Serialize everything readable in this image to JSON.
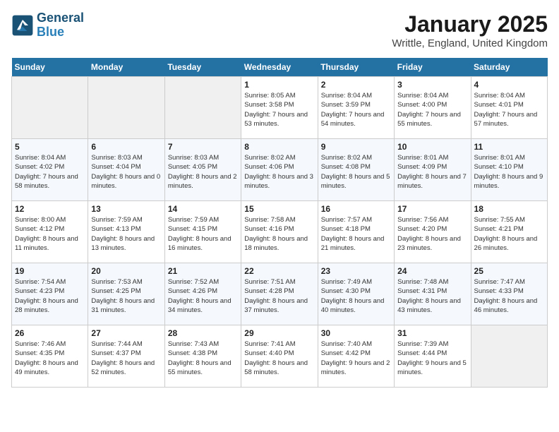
{
  "header": {
    "logo_line1": "General",
    "logo_line2": "Blue",
    "month": "January 2025",
    "location": "Writtle, England, United Kingdom"
  },
  "weekdays": [
    "Sunday",
    "Monday",
    "Tuesday",
    "Wednesday",
    "Thursday",
    "Friday",
    "Saturday"
  ],
  "weeks": [
    [
      {
        "day": "",
        "info": ""
      },
      {
        "day": "",
        "info": ""
      },
      {
        "day": "",
        "info": ""
      },
      {
        "day": "1",
        "info": "Sunrise: 8:05 AM\nSunset: 3:58 PM\nDaylight: 7 hours and 53 minutes."
      },
      {
        "day": "2",
        "info": "Sunrise: 8:04 AM\nSunset: 3:59 PM\nDaylight: 7 hours and 54 minutes."
      },
      {
        "day": "3",
        "info": "Sunrise: 8:04 AM\nSunset: 4:00 PM\nDaylight: 7 hours and 55 minutes."
      },
      {
        "day": "4",
        "info": "Sunrise: 8:04 AM\nSunset: 4:01 PM\nDaylight: 7 hours and 57 minutes."
      }
    ],
    [
      {
        "day": "5",
        "info": "Sunrise: 8:04 AM\nSunset: 4:02 PM\nDaylight: 7 hours and 58 minutes."
      },
      {
        "day": "6",
        "info": "Sunrise: 8:03 AM\nSunset: 4:04 PM\nDaylight: 8 hours and 0 minutes."
      },
      {
        "day": "7",
        "info": "Sunrise: 8:03 AM\nSunset: 4:05 PM\nDaylight: 8 hours and 2 minutes."
      },
      {
        "day": "8",
        "info": "Sunrise: 8:02 AM\nSunset: 4:06 PM\nDaylight: 8 hours and 3 minutes."
      },
      {
        "day": "9",
        "info": "Sunrise: 8:02 AM\nSunset: 4:08 PM\nDaylight: 8 hours and 5 minutes."
      },
      {
        "day": "10",
        "info": "Sunrise: 8:01 AM\nSunset: 4:09 PM\nDaylight: 8 hours and 7 minutes."
      },
      {
        "day": "11",
        "info": "Sunrise: 8:01 AM\nSunset: 4:10 PM\nDaylight: 8 hours and 9 minutes."
      }
    ],
    [
      {
        "day": "12",
        "info": "Sunrise: 8:00 AM\nSunset: 4:12 PM\nDaylight: 8 hours and 11 minutes."
      },
      {
        "day": "13",
        "info": "Sunrise: 7:59 AM\nSunset: 4:13 PM\nDaylight: 8 hours and 13 minutes."
      },
      {
        "day": "14",
        "info": "Sunrise: 7:59 AM\nSunset: 4:15 PM\nDaylight: 8 hours and 16 minutes."
      },
      {
        "day": "15",
        "info": "Sunrise: 7:58 AM\nSunset: 4:16 PM\nDaylight: 8 hours and 18 minutes."
      },
      {
        "day": "16",
        "info": "Sunrise: 7:57 AM\nSunset: 4:18 PM\nDaylight: 8 hours and 21 minutes."
      },
      {
        "day": "17",
        "info": "Sunrise: 7:56 AM\nSunset: 4:20 PM\nDaylight: 8 hours and 23 minutes."
      },
      {
        "day": "18",
        "info": "Sunrise: 7:55 AM\nSunset: 4:21 PM\nDaylight: 8 hours and 26 minutes."
      }
    ],
    [
      {
        "day": "19",
        "info": "Sunrise: 7:54 AM\nSunset: 4:23 PM\nDaylight: 8 hours and 28 minutes."
      },
      {
        "day": "20",
        "info": "Sunrise: 7:53 AM\nSunset: 4:25 PM\nDaylight: 8 hours and 31 minutes."
      },
      {
        "day": "21",
        "info": "Sunrise: 7:52 AM\nSunset: 4:26 PM\nDaylight: 8 hours and 34 minutes."
      },
      {
        "day": "22",
        "info": "Sunrise: 7:51 AM\nSunset: 4:28 PM\nDaylight: 8 hours and 37 minutes."
      },
      {
        "day": "23",
        "info": "Sunrise: 7:49 AM\nSunset: 4:30 PM\nDaylight: 8 hours and 40 minutes."
      },
      {
        "day": "24",
        "info": "Sunrise: 7:48 AM\nSunset: 4:31 PM\nDaylight: 8 hours and 43 minutes."
      },
      {
        "day": "25",
        "info": "Sunrise: 7:47 AM\nSunset: 4:33 PM\nDaylight: 8 hours and 46 minutes."
      }
    ],
    [
      {
        "day": "26",
        "info": "Sunrise: 7:46 AM\nSunset: 4:35 PM\nDaylight: 8 hours and 49 minutes."
      },
      {
        "day": "27",
        "info": "Sunrise: 7:44 AM\nSunset: 4:37 PM\nDaylight: 8 hours and 52 minutes."
      },
      {
        "day": "28",
        "info": "Sunrise: 7:43 AM\nSunset: 4:38 PM\nDaylight: 8 hours and 55 minutes."
      },
      {
        "day": "29",
        "info": "Sunrise: 7:41 AM\nSunset: 4:40 PM\nDaylight: 8 hours and 58 minutes."
      },
      {
        "day": "30",
        "info": "Sunrise: 7:40 AM\nSunset: 4:42 PM\nDaylight: 9 hours and 2 minutes."
      },
      {
        "day": "31",
        "info": "Sunrise: 7:39 AM\nSunset: 4:44 PM\nDaylight: 9 hours and 5 minutes."
      },
      {
        "day": "",
        "info": ""
      }
    ]
  ]
}
